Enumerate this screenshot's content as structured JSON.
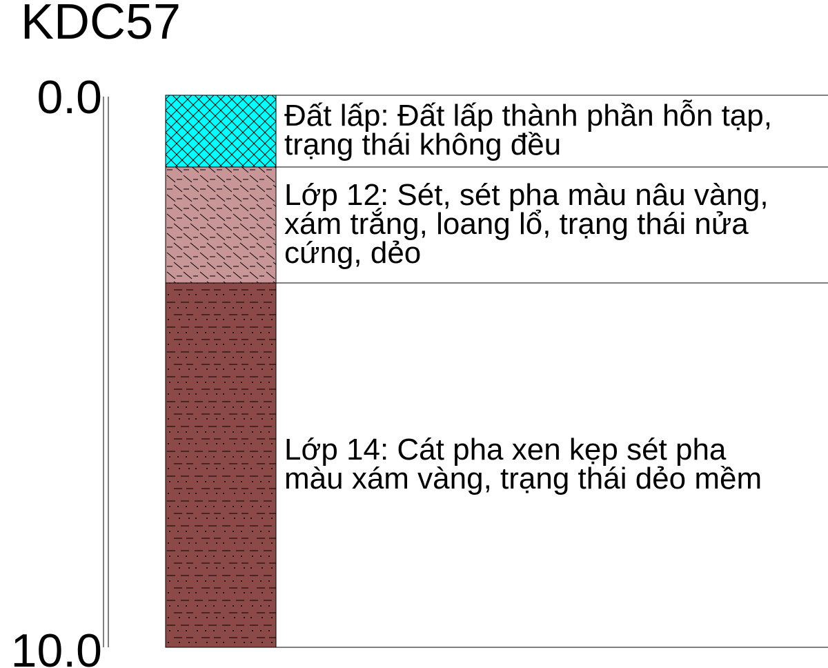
{
  "borehole": {
    "name": "KDC57",
    "depth_top_label": "0.0",
    "depth_bottom_label": "10.0",
    "depth_top": 0.0,
    "depth_bottom": 10.0
  },
  "layers": [
    {
      "top": 0.0,
      "bottom": 1.3,
      "fill": "#00ffff",
      "pattern": "crosshatch",
      "lines": [
        "Đất lấp: Đất lấp thành phần hỗn tạp,",
        "trạng thái không đều"
      ]
    },
    {
      "top": 1.3,
      "bottom": 3.4,
      "fill": "#c89696",
      "pattern": "clay-diagonal-dash",
      "lines": [
        "Lớp 12: Sét, sét pha màu nâu vàng,",
        "xám trắng, loang lổ, trạng thái nửa",
        "cứng, dẻo"
      ]
    },
    {
      "top": 3.4,
      "bottom": 10.0,
      "fill": "#8b4a47",
      "pattern": "sand-dot-dash",
      "lines": [
        "Lớp 14: Cát pha xen kẹp sét pha",
        "màu xám vàng, trạng thái dẻo mềm"
      ]
    }
  ]
}
